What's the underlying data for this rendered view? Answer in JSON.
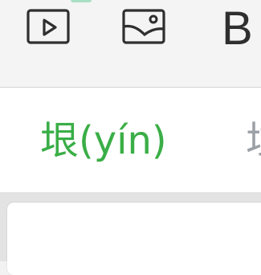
{
  "toolbar": {
    "video_icon": "video-play-icon",
    "image_icon": "image-icon",
    "bold_label": "B"
  },
  "words": {
    "active": "垠(yín)",
    "next": "垃"
  },
  "colors": {
    "accent": "#3aae46",
    "inactive": "#9aa0a6"
  }
}
